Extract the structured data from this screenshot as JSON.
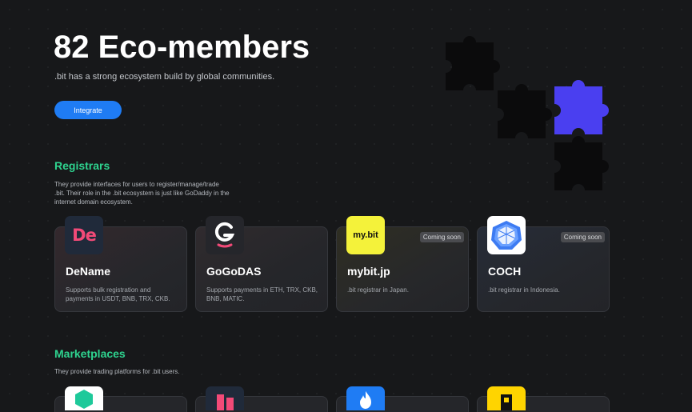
{
  "hero": {
    "title": "82 Eco-members",
    "subtitle": ".bit has a strong ecosystem build by global communities.",
    "cta_label": "Integrate"
  },
  "registrars": {
    "title": "Registrars",
    "description": "They provide interfaces for users to register/manage/trade .bit. Their role in the .bit ecosystem is just like GoDaddy in the internet domain ecosystem.",
    "cards": [
      {
        "name": "DeName",
        "description": "Supports bulk registration and payments in USDT, BNB, TRX, CKB.",
        "badge": "",
        "logo_text": "De",
        "logo_icon": "dename-logo"
      },
      {
        "name": "GoGoDAS",
        "description": "Supports payments in ETH, TRX, CKB, BNB, MATIC.",
        "badge": "",
        "logo_text": "G",
        "logo_icon": "gogodas-logo"
      },
      {
        "name": "mybit.jp",
        "description": ".bit registrar in Japan.",
        "badge": "Coming soon",
        "logo_text": "my.bit",
        "logo_icon": "mybit-logo"
      },
      {
        "name": "COCH",
        "description": ".bit registrar in Indonesia.",
        "badge": "Coming soon",
        "logo_text": "",
        "logo_icon": "coch-logo"
      }
    ]
  },
  "marketplaces": {
    "title": "Marketplaces",
    "description": "They provide trading platforms for .bit users.",
    "logo_icons": [
      "hexagon-logo",
      "dename-logo",
      "flame-logo",
      "b-logo"
    ]
  },
  "colors": {
    "accent_green": "#2ed38f",
    "button_blue": "#1f7cf4",
    "puzzle_blue": "#4a3ff0",
    "background": "#17181a"
  }
}
